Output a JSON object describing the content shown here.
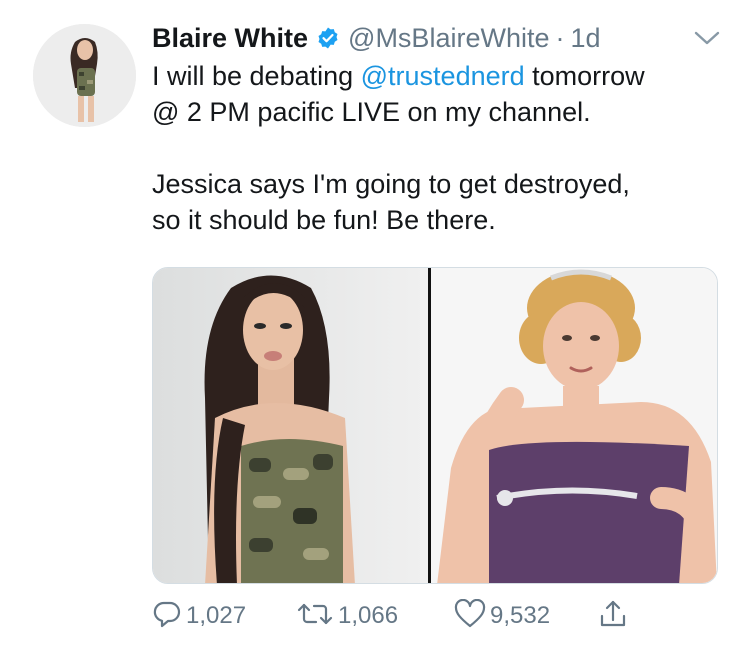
{
  "tweet": {
    "author_name": "Blaire White",
    "handle": "@MsBlaireWhite",
    "separator": "·",
    "time": "1d",
    "line1_pre": "I will be debating ",
    "line1_mention": "@trustednerd",
    "line1_post": " tomorrow",
    "line2": "@ 2 PM pacific LIVE on my channel.",
    "line3": "Jessica says I'm going to get destroyed,",
    "line4": "so it should be fun! Be there."
  },
  "actions": {
    "replies": "1,027",
    "retweets": "1,066",
    "likes": "9,532"
  },
  "icons": {
    "verified": "verified-badge-icon",
    "caret": "chevron-down-icon",
    "reply": "reply-icon",
    "retweet": "retweet-icon",
    "like": "heart-icon",
    "share": "share-icon"
  },
  "colors": {
    "link": "#1b95e0",
    "verified": "#1da1f2",
    "muted": "#657786"
  }
}
